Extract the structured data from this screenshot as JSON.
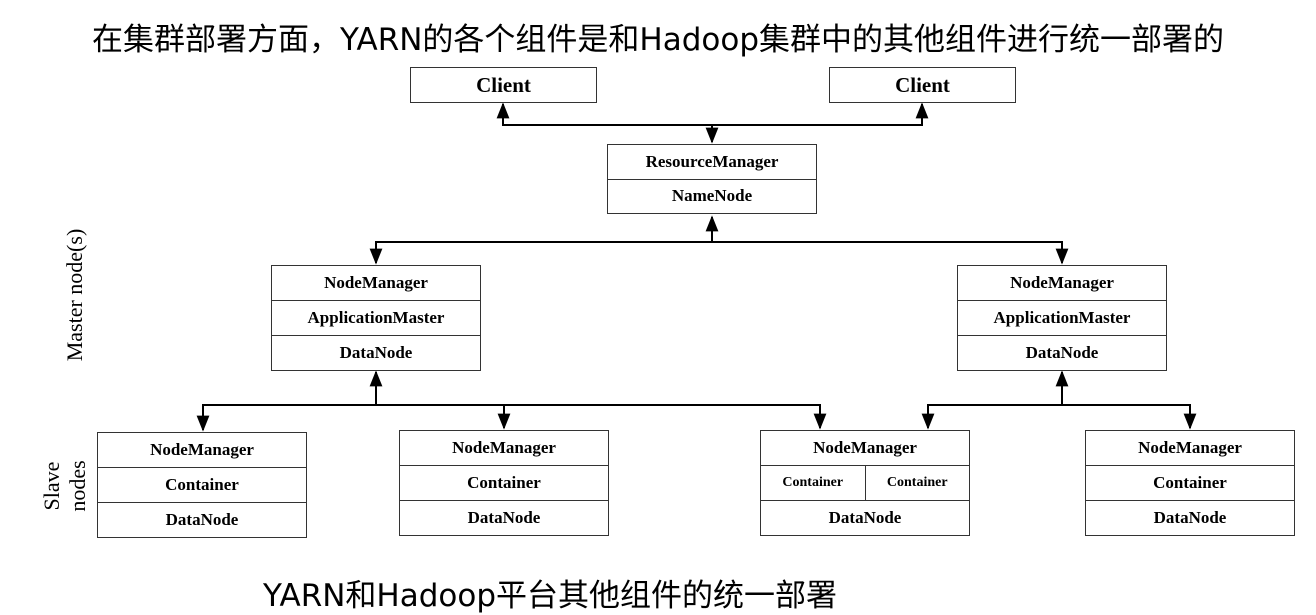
{
  "title": "在集群部署方面，YARN的各个组件是和Hadoop集群中的其他组件进行统一部署的",
  "caption": "YARN和Hadoop平台其他组件的统一部署",
  "labels": {
    "master": "Master node(s)",
    "slave_line1": "Slave",
    "slave_line2": "nodes"
  },
  "clients": [
    "Client",
    "Client"
  ],
  "resource_manager": {
    "line1": "ResourceManager",
    "line2": "NameNode"
  },
  "master_nodes": [
    {
      "line1": "NodeManager",
      "line2": "ApplicationMaster",
      "line3": "DataNode"
    },
    {
      "line1": "NodeManager",
      "line2": "ApplicationMaster",
      "line3": "DataNode"
    }
  ],
  "slave_nodes": [
    {
      "line1": "NodeManager",
      "line2": "Container",
      "line3": "DataNode"
    },
    {
      "line1": "NodeManager",
      "line2": "Container",
      "line3": "DataNode"
    },
    {
      "line1": "NodeManager",
      "container_a": "Container",
      "container_b": "Container",
      "line3": "DataNode"
    },
    {
      "line1": "NodeManager",
      "line2": "Container",
      "line3": "DataNode"
    }
  ]
}
